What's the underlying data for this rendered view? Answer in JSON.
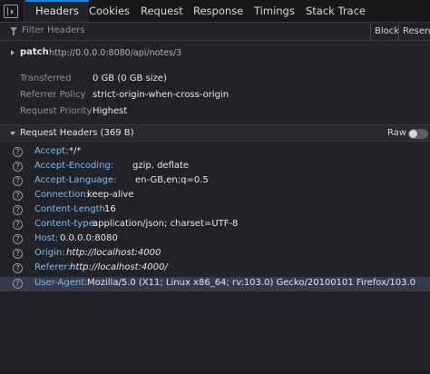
{
  "tabs": [
    {
      "label": "Headers",
      "active": true
    },
    {
      "label": "Cookies",
      "active": false
    },
    {
      "label": "Request",
      "active": false
    },
    {
      "label": "Response",
      "active": false
    },
    {
      "label": "Timings",
      "active": false
    },
    {
      "label": "Stack Trace",
      "active": false
    }
  ],
  "filter": {
    "placeholder": "Filter Headers",
    "block_label": "Block",
    "resend_label": "Resend"
  },
  "request": {
    "method": "patch",
    "url": "http://0.0.0.0:8080/api/notes/3"
  },
  "summary": [
    {
      "label": "Transferred",
      "value": "0 GB (0 GB size)"
    },
    {
      "label": "Referrer Policy",
      "value": "strict-origin-when-cross-origin"
    },
    {
      "label": "Request Priority",
      "value": "Highest"
    }
  ],
  "request_headers": {
    "title": "Request Headers (369 B)",
    "raw_label": "Raw",
    "raw_enabled": false,
    "items": [
      {
        "name": "Accept:",
        "value": "*/*"
      },
      {
        "name": "Accept-Encoding:",
        "value": "gzip, deflate"
      },
      {
        "name": "Accept-Language:",
        "value": "en-GB,en;q=0.5"
      },
      {
        "name": "Connection:",
        "value": "keep-alive"
      },
      {
        "name": "Content-Length:",
        "value": "16"
      },
      {
        "name": "Content-type:",
        "value": "application/json; charset=UTF-8"
      },
      {
        "name": "Host:",
        "value": "0.0.0.0:8080"
      },
      {
        "name": "Origin:",
        "value": "http://localhost:4000"
      },
      {
        "name": "Referer:",
        "value": "http://localhost:4000/"
      },
      {
        "name": "User-Agent:",
        "value": "Mozilla/5.0 (X11; Linux x86_64; rv:103.0) Gecko/20100101 Firefox/103.0"
      }
    ]
  },
  "icons": {
    "panel_toggle": "sidebar-toggle-icon",
    "filter": "filter-icon",
    "help": "question-circle-icon"
  },
  "colors": {
    "accent": "#0a84ff",
    "header_name": "#75bfff",
    "background": "#232327"
  }
}
